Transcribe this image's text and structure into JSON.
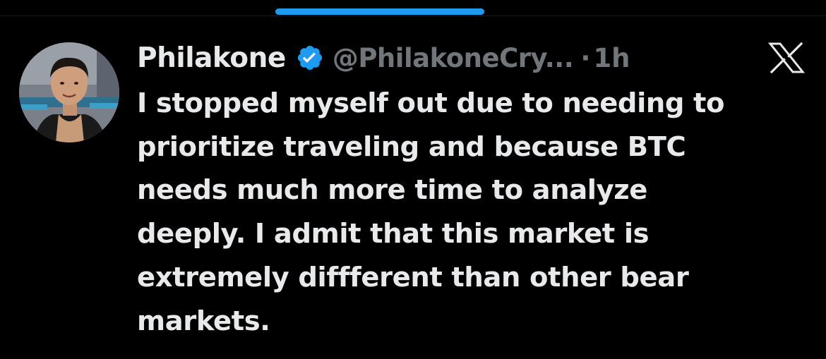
{
  "colors": {
    "background": "#000000",
    "progress": "#1d9bf0",
    "text": "#e7e9ea",
    "secondary_text": "#71767b",
    "verified": "#1d9bf0"
  },
  "tweet": {
    "display_name": "Philakone",
    "handle": "@PhilakoneCry...",
    "separator": "·",
    "time": "1h",
    "text_lines": [
      "I stopped myself out due to needing to",
      "prioritize traveling and because BTC",
      "needs much more time to analyze",
      "deeply. I admit that this market is",
      "extremely diffferent than other bear",
      "markets."
    ]
  },
  "icons": {
    "avatar": "profile-photo",
    "verified": "verified-badge-icon",
    "menu": "x-logo-icon"
  }
}
